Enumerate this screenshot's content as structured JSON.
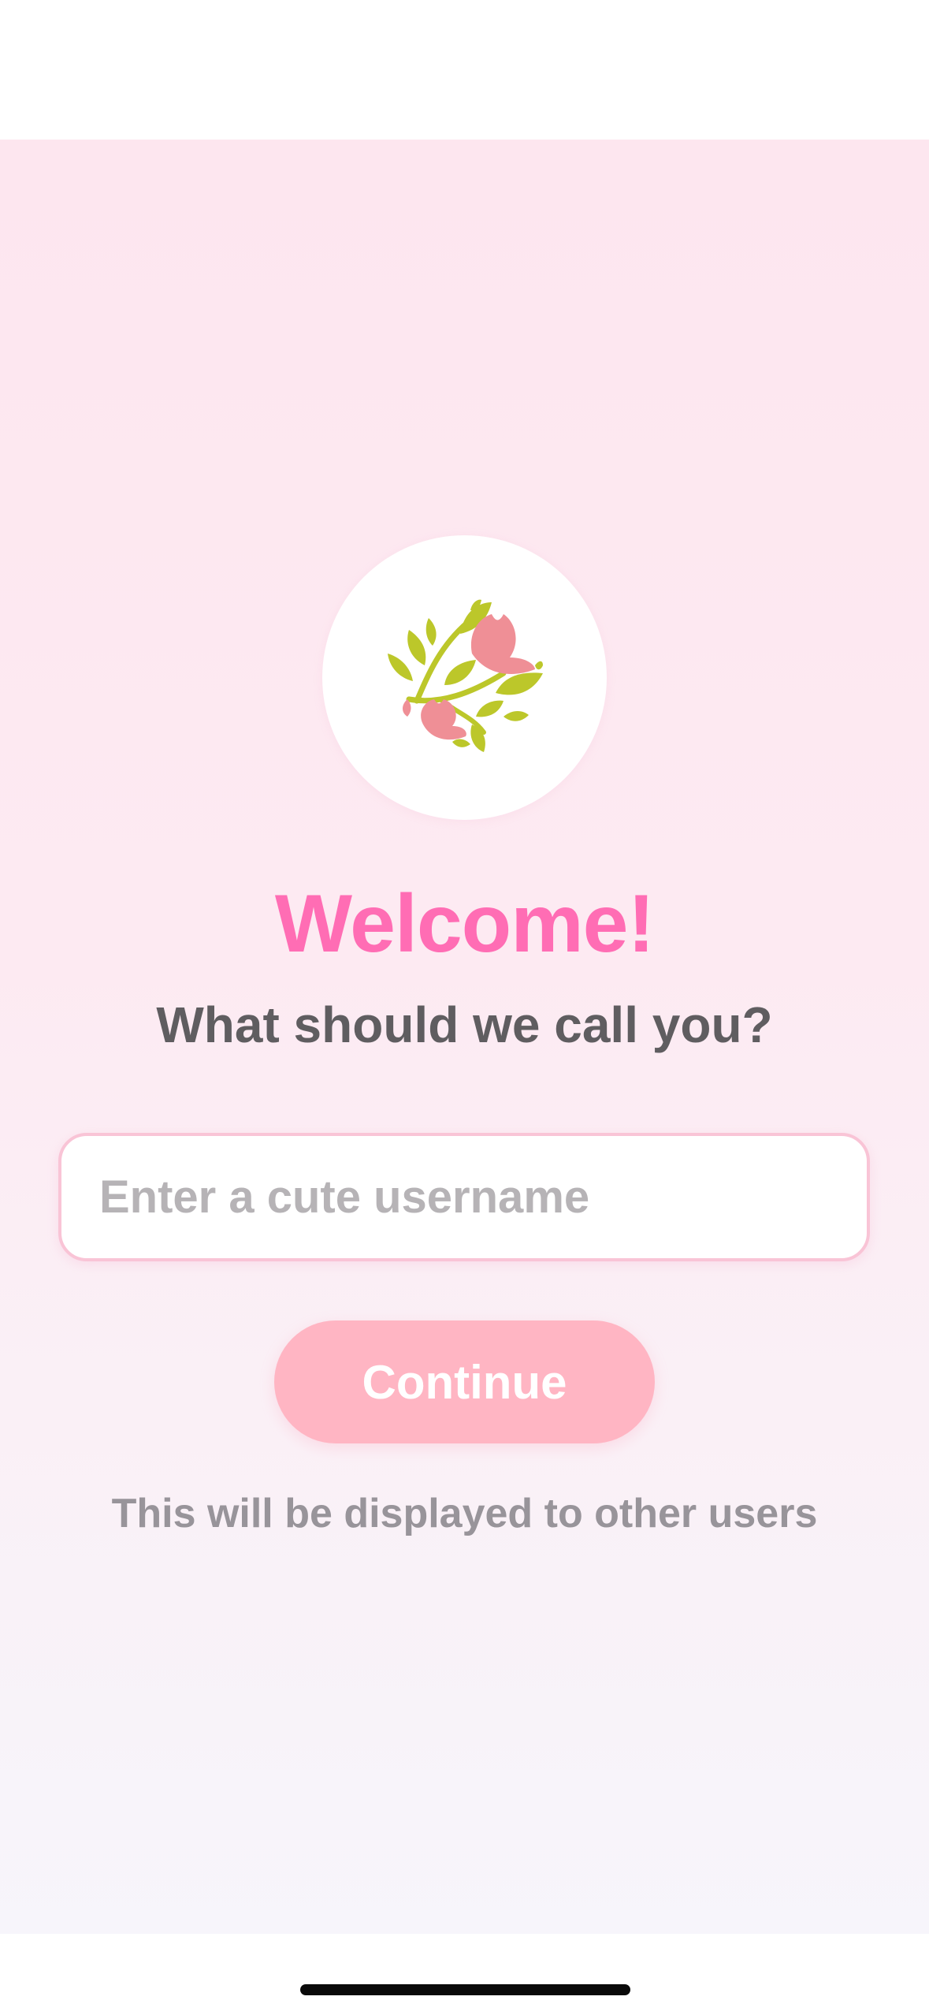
{
  "onboarding": {
    "logo_icon": "floral-wreath-icon",
    "title": "Welcome!",
    "subtitle": "What should we call you?",
    "username": {
      "value": "",
      "placeholder": "Enter a cute username"
    },
    "continue_label": "Continue",
    "helper_text": "This will be displayed to other users"
  },
  "colors": {
    "title_pink": "#ff6db4",
    "button_pink": "#ffb5c3",
    "input_border": "#f9c4d6",
    "leaf_green": "#bcc72a",
    "flower_pink": "#ef8f96",
    "background_top": "#fde6ef",
    "background_bottom": "#f7f5fb"
  }
}
